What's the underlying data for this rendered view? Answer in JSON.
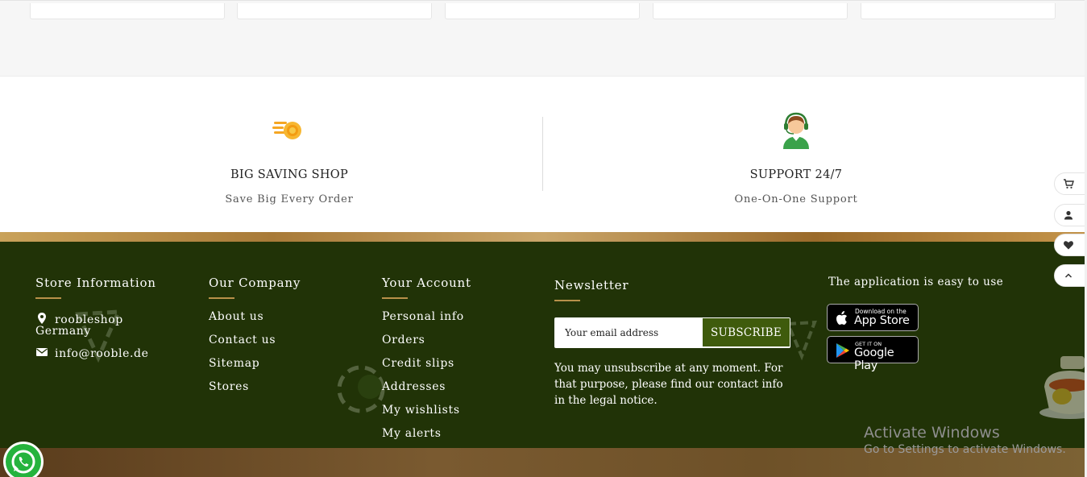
{
  "services": [
    {
      "title": "BIG SAVING SHOP",
      "subtitle": "Save Big Every Order",
      "icon": "coins-icon"
    },
    {
      "title": "SUPPORT 24/7",
      "subtitle": "One-On-One Support",
      "icon": "support-agent-icon"
    }
  ],
  "footer": {
    "store": {
      "heading": "Store Information",
      "address_line1": "roobleshop",
      "address_line2": "Germany",
      "email": "info@rooble.de"
    },
    "company": {
      "heading": "Our Company",
      "links": [
        "About us",
        "Contact us",
        "Sitemap",
        "Stores"
      ]
    },
    "account": {
      "heading": "Your Account",
      "links": [
        "Personal info",
        "Orders",
        "Credit slips",
        "Addresses",
        "My wishlists",
        "My alerts"
      ]
    },
    "newsletter": {
      "heading": "Newsletter",
      "placeholder": "Your email address",
      "button": "SUBSCRIBE",
      "note": "You may unsubscribe at any moment. For that purpose, please find our contact info in the legal notice."
    },
    "app": {
      "heading": "The application is easy to use",
      "appstore_small": "Download on the",
      "appstore_big": "App Store",
      "googleplay_small": "GET IT ON",
      "googleplay_big": "Google Play"
    }
  },
  "floating_tools": [
    "cart-icon",
    "user-icon",
    "heart-icon",
    "chevron-up-icon"
  ],
  "overlay": {
    "activate_title": "Activate Windows",
    "activate_sub": "Go to Settings to activate Windows."
  },
  "colors": {
    "footer_bg": "#213307",
    "accent_gold": "#b8904a",
    "subscribe_bg": "#3f5b0c",
    "whatsapp": "#25b33d"
  }
}
